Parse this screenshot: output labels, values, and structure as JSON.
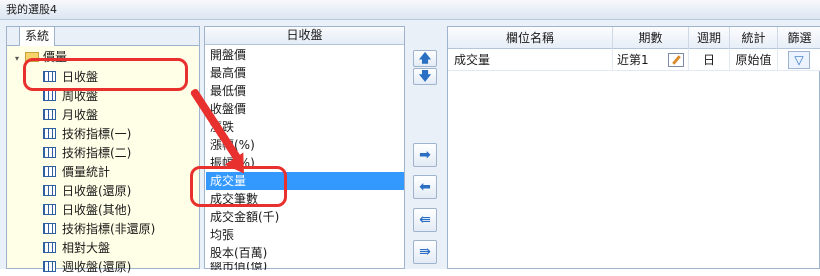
{
  "window": {
    "title": "我的選股4"
  },
  "tree": {
    "tab_label": "系統",
    "root": {
      "expander": "▾",
      "label": "價量"
    },
    "items": [
      {
        "label": "日收盤"
      },
      {
        "label": "周收盤"
      },
      {
        "label": "月收盤"
      },
      {
        "label": "技術指標(一)"
      },
      {
        "label": "技術指標(二)"
      },
      {
        "label": "價量統計"
      },
      {
        "label": "日收盤(還原)"
      },
      {
        "label": "日收盤(其他)"
      },
      {
        "label": "技術指標(非還原)"
      },
      {
        "label": "相對大盤"
      },
      {
        "label": "週收盤(還原)"
      }
    ]
  },
  "list": {
    "header": "日收盤",
    "items": [
      {
        "label": "開盤價"
      },
      {
        "label": "最高價"
      },
      {
        "label": "最低價"
      },
      {
        "label": "收盤價"
      },
      {
        "label": "漲跌"
      },
      {
        "label": "漲幅(%)"
      },
      {
        "label": "振幅(%)"
      },
      {
        "label": "成交量"
      },
      {
        "label": "成交筆數"
      },
      {
        "label": "成交金額(千)"
      },
      {
        "label": "均張"
      },
      {
        "label": "股本(百萬)"
      },
      {
        "label": "總市值(億)"
      }
    ],
    "selected_index": 7
  },
  "buttons": {
    "move_up": "🡅",
    "move_down": "🡇",
    "add": "➡",
    "remove": "⬅",
    "remove_all": "⇚",
    "add_all": "⇛"
  },
  "grid": {
    "headers": {
      "field": "欄位名稱",
      "period": "期數",
      "cycle": "週期",
      "stat": "統計",
      "filter": "篩選"
    },
    "rows": [
      {
        "field": "成交量",
        "period": "近第1",
        "cycle": "日",
        "stat": "原始值",
        "filter_icon": "funnel-icon"
      }
    ]
  },
  "colors": {
    "annotation": "#e8312e",
    "selection": "#3399ff"
  }
}
